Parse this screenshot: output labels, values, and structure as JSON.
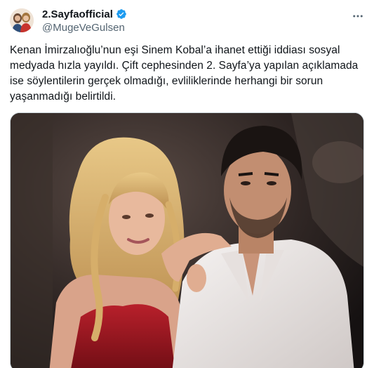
{
  "tweet": {
    "author": {
      "display_name": "2.Sayfaofficial",
      "handle": "@MugeVeGulsen",
      "verified": true,
      "avatar_icon": "profile-avatar"
    },
    "more_icon": "more-horizontal-icon",
    "text_lines": [
      "Kenan İmirzalıoğlu’nun eşi Sinem Kobal’a ihanet ettiği iddiası sosyal",
      "medyada hızla yayıldı. Çift cephesinden 2. Sayfa’ya yapılan açıklamada",
      "ise söylentilerin gerçek olmadığı, evliliklerinde herhangi bir sorun",
      "yaşanmadığı belirtildi."
    ],
    "media": {
      "type": "photo"
    },
    "colors": {
      "text": "#0f1419",
      "secondary": "#536471",
      "verified_blue": "#1d9bf0",
      "border": "#cfd9de"
    }
  }
}
